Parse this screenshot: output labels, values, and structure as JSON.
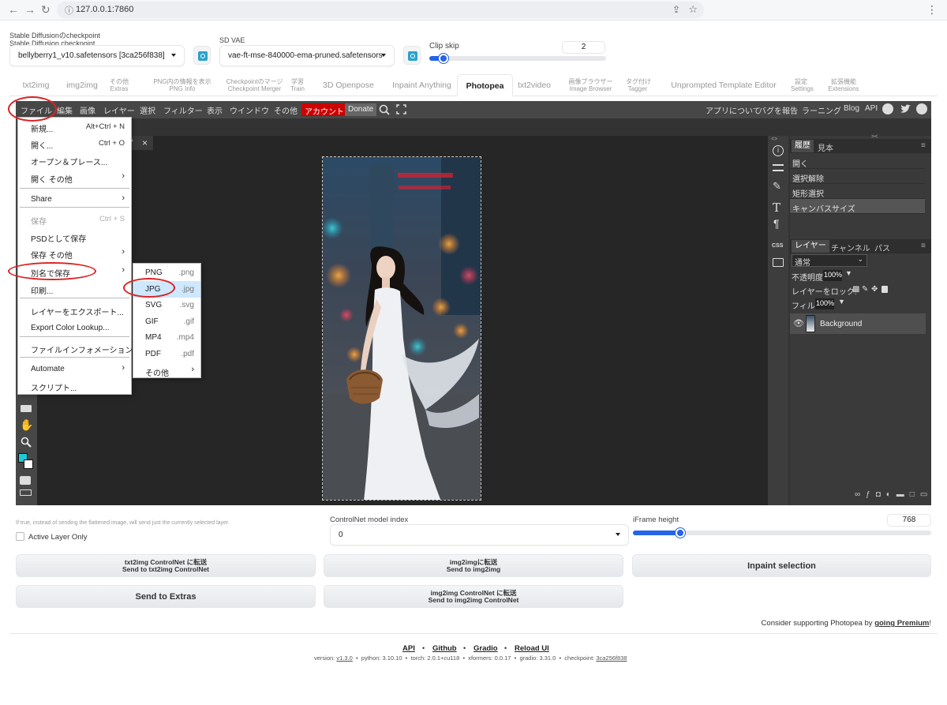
{
  "browser": {
    "url": "127.0.0.1:7860"
  },
  "settings": {
    "checkpoint_label1": "Stable Diffusionのcheckpoint",
    "checkpoint_label2": "Stable Diffusion checkpoint",
    "checkpoint_value": "bellyberry1_v10.safetensors [3ca256f838]",
    "vae_label": "SD VAE",
    "vae_value": "vae-ft-mse-840000-ema-pruned.safetensors",
    "clip_label": "Clip skip",
    "clip_value": "2",
    "clip_level": 0.08
  },
  "tabs": [
    {
      "l1": "txt2img",
      "l2": ""
    },
    {
      "l1": "img2img",
      "l2": ""
    },
    {
      "l1": "その他",
      "l2": "Extras"
    },
    {
      "l1": "PNG内の情報を表示",
      "l2": "PNG Info"
    },
    {
      "l1": "Checkpointのマージ",
      "l2": "Checkpoint Merger"
    },
    {
      "l1": "学習",
      "l2": "Train"
    },
    {
      "l1": "3D Openpose",
      "l2": ""
    },
    {
      "l1": "Inpaint Anything",
      "l2": ""
    },
    {
      "l1": "Photopea",
      "l2": ""
    },
    {
      "l1": "txt2video",
      "l2": ""
    },
    {
      "l1": "画像ブラウザー",
      "l2": "Image Browser"
    },
    {
      "l1": "タグ付け",
      "l2": "Tagger"
    },
    {
      "l1": "Unprompted Template Editor",
      "l2": ""
    },
    {
      "l1": "設定",
      "l2": "Settings"
    },
    {
      "l1": "拡張機能",
      "l2": "Extensions"
    }
  ],
  "pp_menu": [
    "ファイル",
    "編集",
    "画像",
    "レイヤー",
    "選択",
    "フィルター",
    "表示",
    "ウインドウ",
    "その他"
  ],
  "pp_account": "アカウント",
  "pp_donate": "Donate",
  "pp_right": [
    "アプリについて",
    "バグを報告",
    "ラーニング",
    "Blog",
    "API"
  ],
  "file_menu": [
    {
      "label": "新規...",
      "shortcut": "Alt+Ctrl + N"
    },
    {
      "label": "開く...",
      "shortcut": "Ctrl + O"
    },
    {
      "label": "オープン＆プレース...",
      "shortcut": ""
    },
    {
      "label": "開く その他",
      "shortcut": "›"
    },
    {
      "label": "Share",
      "shortcut": "›"
    },
    {
      "label": "保存",
      "shortcut": "Ctrl + S"
    },
    {
      "label": "PSDとして保存",
      "shortcut": ""
    },
    {
      "label": "保存 その他",
      "shortcut": "›"
    },
    {
      "label": "別名で保存",
      "shortcut": "›"
    },
    {
      "label": "印刷...",
      "shortcut": ""
    },
    {
      "label": "レイヤーをエクスポート...",
      "shortcut": ""
    },
    {
      "label": "Export Color Lookup...",
      "shortcut": ""
    },
    {
      "label": "ファイルインフォメーション...",
      "shortcut": ""
    },
    {
      "label": "Automate",
      "shortcut": "›"
    },
    {
      "label": "スクリプト...",
      "shortcut": ""
    }
  ],
  "save_as_menu": [
    {
      "label": "PNG",
      "ext": ".png"
    },
    {
      "label": "JPG",
      "ext": ".jpg"
    },
    {
      "label": "SVG",
      "ext": ".svg"
    },
    {
      "label": "GIF",
      "ext": ".gif"
    },
    {
      "label": "MP4",
      "ext": ".mp4"
    },
    {
      "label": "PDF",
      "ext": ".pdf"
    },
    {
      "label": "その他",
      "ext": "›"
    }
  ],
  "doc_tab_close": "×",
  "doc_tab_mark": "*",
  "history_tabs": [
    "履歴",
    "見本"
  ],
  "history": [
    "開く",
    "選択解除",
    "矩形選択",
    "キャンバスサイズ"
  ],
  "layer_tabs": [
    "レイヤー",
    "チャンネル",
    "パス"
  ],
  "blend_mode": "通常",
  "opacity_label": "不透明度:",
  "opacity_value": "100%",
  "lock_label": "レイヤーをロック:",
  "fill_label": "フィル:",
  "fill_value": "100%",
  "layer_name": "Background",
  "css_icon": "CSS",
  "bottom": {
    "active_desc": "If true, instead of sending the flattened image, will send just the currently selected layer.",
    "active_label": "Active Layer Only",
    "cn_label": "ControlNet model index",
    "cn_value": "0",
    "iframe_label": "iFrame height",
    "iframe_value": "768",
    "iframe_level": 0.16,
    "btn1a": "txt2img ControlNet に転送",
    "btn1b": "Send to txt2img ControlNet",
    "btn2a": "img2imgに転送",
    "btn2b": "Send to img2img",
    "btn3": "Inpaint selection",
    "btn4": "Send to Extras",
    "btn5a": "img2img ControlNet に転送",
    "btn5b": "Send to img2img ControlNet",
    "support_pre": "Consider supporting Photopea by ",
    "support_link": "going Premium",
    "support_post": "!"
  },
  "footer": {
    "links": [
      "API",
      "Github",
      "Gradio",
      "Reload UI"
    ],
    "bullet": "•",
    "version_label": "version: ",
    "version": "v1.3.0",
    "python": "python: 3.10.10",
    "torch": "torch: 2.0.1+cu118",
    "xformers": "xformers: 0.0.17",
    "gradio": "gradio: 3.31.0",
    "checkpoint_label": "checkpoint: ",
    "checkpoint": "3ca256f838"
  },
  "colors": {
    "accent": "#2563eb",
    "annotation": "#dd2222",
    "account": "#cc0000",
    "highlight": "#cde8ff"
  }
}
